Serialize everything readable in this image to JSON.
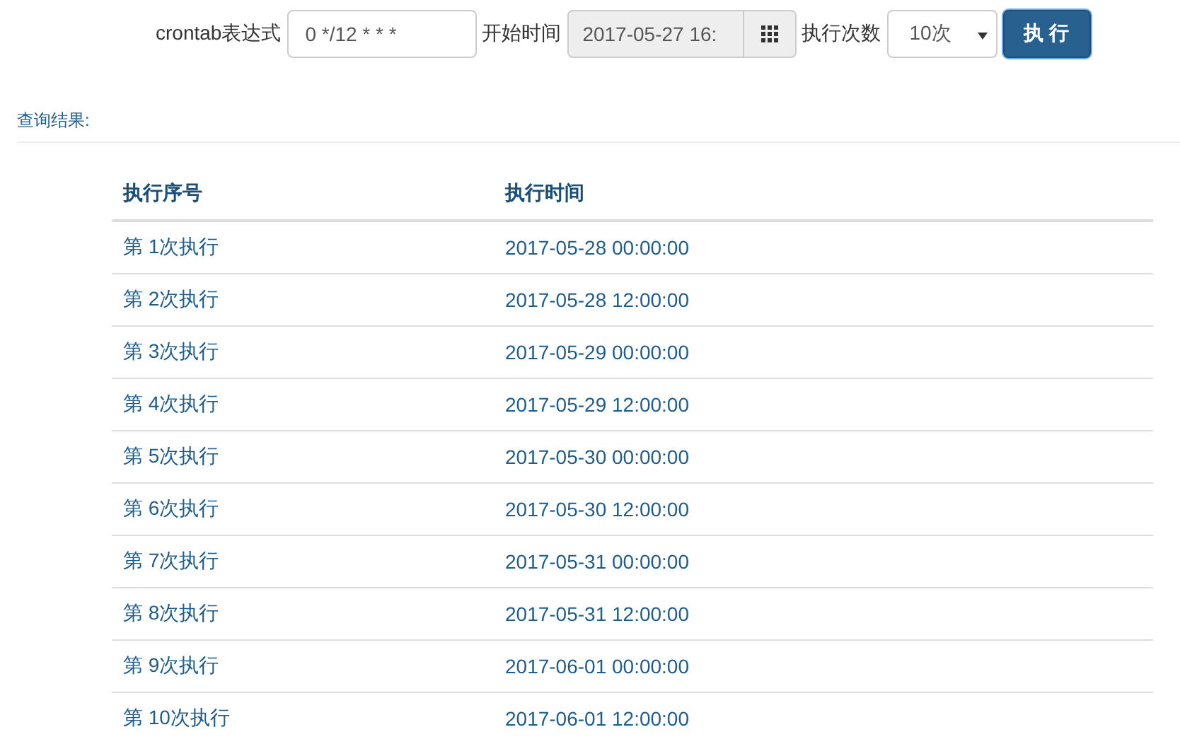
{
  "form": {
    "expression_label": "crontab表达式",
    "expression_value": "0 */12 * * *",
    "start_label": "开始时间",
    "start_value": "2017-05-27 16:",
    "count_label": "执行次数",
    "count_value": "10次",
    "submit": "执 行"
  },
  "result_title": "查询结果:",
  "table": {
    "columns": [
      "执行序号",
      "执行时间"
    ],
    "rows": [
      [
        "第 1次执行",
        "2017-05-28 00:00:00"
      ],
      [
        "第 2次执行",
        "2017-05-28 12:00:00"
      ],
      [
        "第 3次执行",
        "2017-05-29 00:00:00"
      ],
      [
        "第 4次执行",
        "2017-05-29 12:00:00"
      ],
      [
        "第 5次执行",
        "2017-05-30 00:00:00"
      ],
      [
        "第 6次执行",
        "2017-05-30 12:00:00"
      ],
      [
        "第 7次执行",
        "2017-05-31 00:00:00"
      ],
      [
        "第 8次执行",
        "2017-05-31 12:00:00"
      ],
      [
        "第 9次执行",
        "2017-06-01 00:00:00"
      ],
      [
        "第 10次执行",
        "2017-06-01 12:00:00"
      ]
    ]
  }
}
